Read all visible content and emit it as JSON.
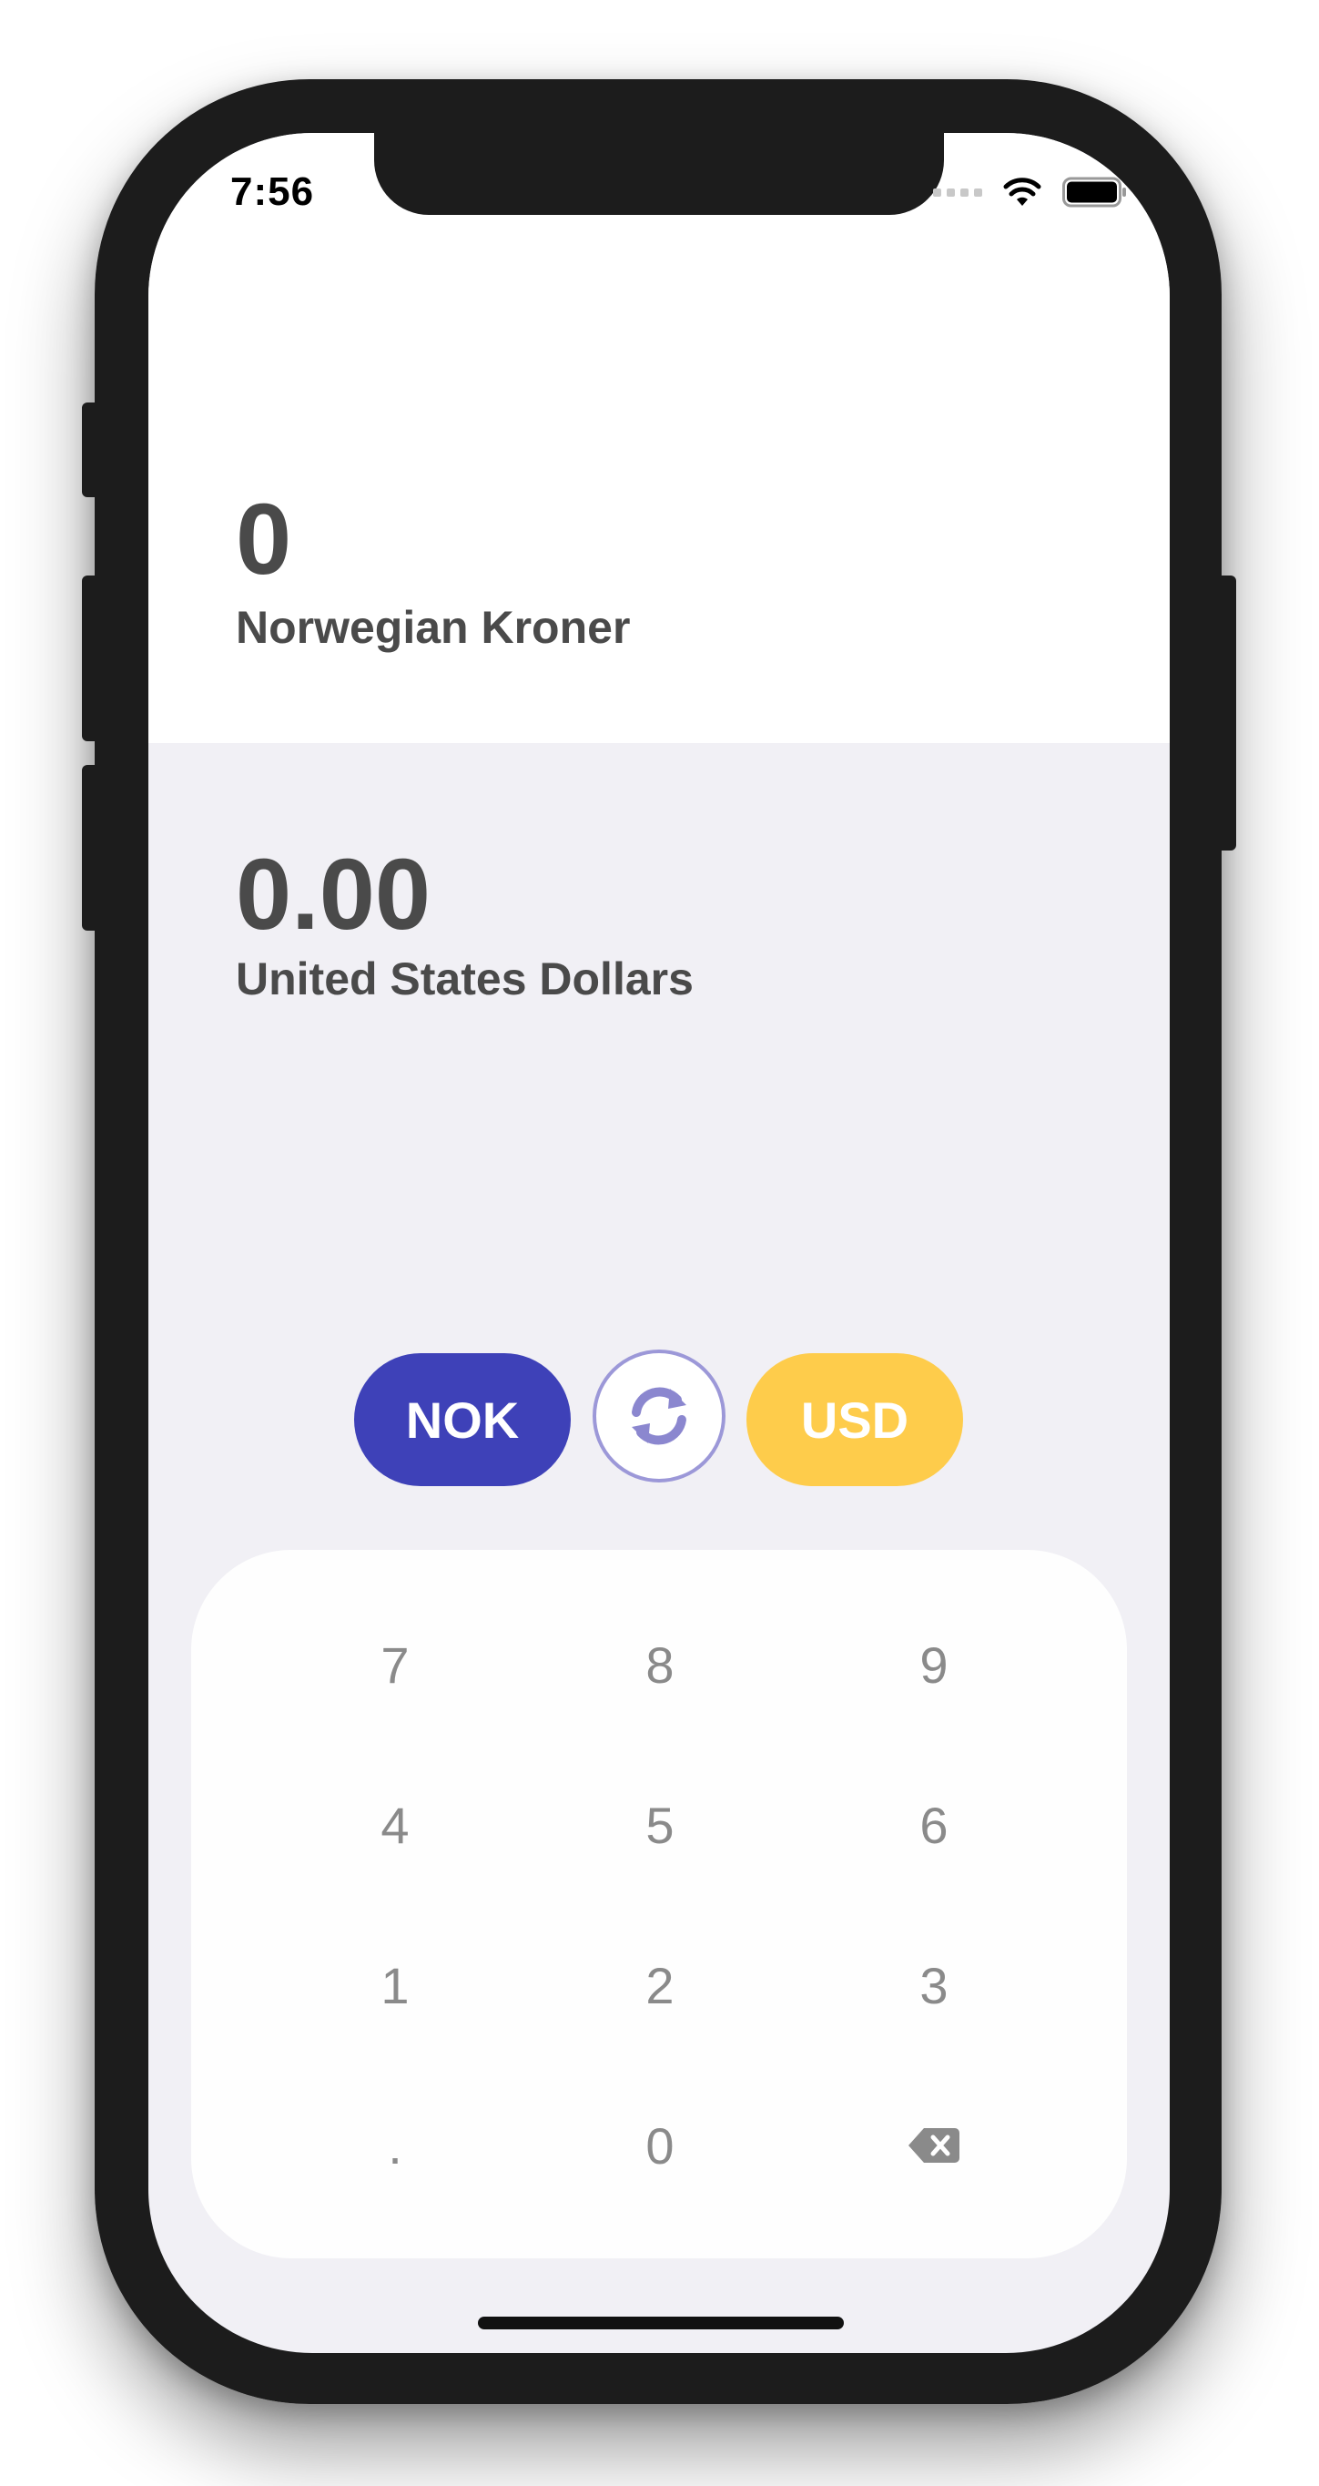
{
  "status_bar": {
    "time": "7:56"
  },
  "source": {
    "amount": "0",
    "currency_name": "Norwegian Kroner"
  },
  "target": {
    "amount": "0.00",
    "currency_name": "United States Dollars"
  },
  "selectors": {
    "from_code": "NOK",
    "to_code": "USD",
    "from_color": "#3e41b8",
    "to_color": "#fecc4b",
    "swap_icon": "swap-arrows-icon"
  },
  "keypad": {
    "keys": [
      "7",
      "8",
      "9",
      "4",
      "5",
      "6",
      "1",
      "2",
      "3",
      ".",
      "0"
    ],
    "backspace_icon": "backspace-icon"
  }
}
